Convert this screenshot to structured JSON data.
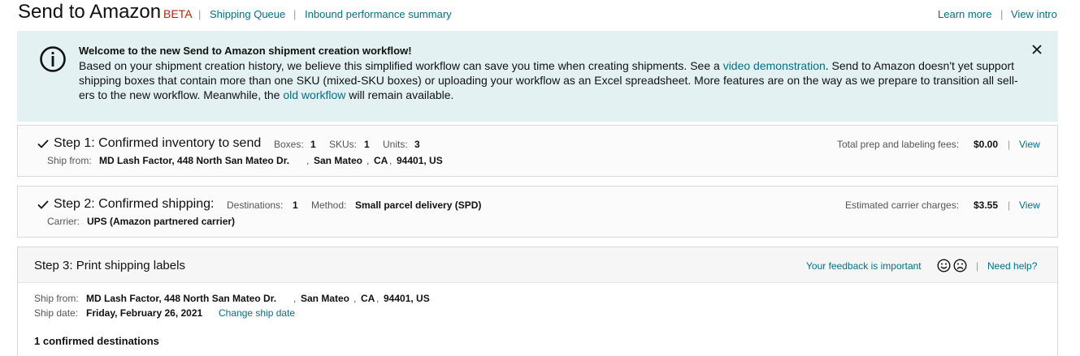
{
  "header": {
    "title": "Send to Amazon",
    "beta": "BETA",
    "links": [
      "Shipping Queue",
      "Inbound performance summary"
    ],
    "right_links": [
      "Learn more",
      "View intro"
    ],
    "separator": "|"
  },
  "banner": {
    "icon": "info-icon",
    "title": "Welcome to the new Send to Amazon shipment creation workflow!",
    "text_1": "Based on your shipment creation history, we believe this simplified workflow can save you time when creating shipments. See a ",
    "link_1": "video demonstration",
    "text_2": ". Send to Amazon doesn't yet support shipping boxes that contain more than one SKU (mixed-SKU boxes) or uploading your workflow as an Excel spreadsheet. More features are on the way as we prepare to transition all sell-ers to the new workflow. Meanwhile, the ",
    "link_2": "old workflow",
    "text_3": " will remain available.",
    "close_icon": "close-icon"
  },
  "step1": {
    "title": "Step 1: Confirmed inventory to send",
    "boxes_label": "Boxes:",
    "boxes": "1",
    "skus_label": "SKUs:",
    "skus": "1",
    "units_label": "Units:",
    "units": "3",
    "ship_from_label": "Ship from:",
    "ship_from_parts": [
      "MD Lash Factor, 448 North San Mateo Dr.",
      ",",
      "San Mateo",
      ",",
      "CA",
      ",",
      "94401, US"
    ],
    "fees_label": "Total prep and labeling fees:",
    "fees": "$0.00",
    "view": "View"
  },
  "step2": {
    "title": "Step 2: Confirmed shipping:",
    "dest_label": "Destinations:",
    "dest": "1",
    "method_label": "Method:",
    "method": "Small parcel delivery (SPD)",
    "carrier_label": "Carrier:",
    "carrier": "UPS (Amazon partnered carrier)",
    "charges_label": "Estimated carrier charges:",
    "charges": "$3.55",
    "view": "View"
  },
  "step3": {
    "title": "Step 3: Print shipping labels",
    "feedback": "Your feedback is important",
    "help": "Need help?",
    "ship_from_label": "Ship from:",
    "ship_from_parts": [
      "MD Lash Factor, 448 North San Mateo Dr.",
      ",",
      "San Mateo",
      ",",
      "CA",
      ",",
      "94401, US"
    ],
    "ship_date_label": "Ship date:",
    "ship_date": "Friday, February 26, 2021",
    "change_date": "Change ship date",
    "confirmed": "1 confirmed destinations"
  },
  "colors": {
    "link": "#007185",
    "beta": "#b12704",
    "banner_bg": "#e3f1f3",
    "card_border": "#d5d9d9"
  }
}
